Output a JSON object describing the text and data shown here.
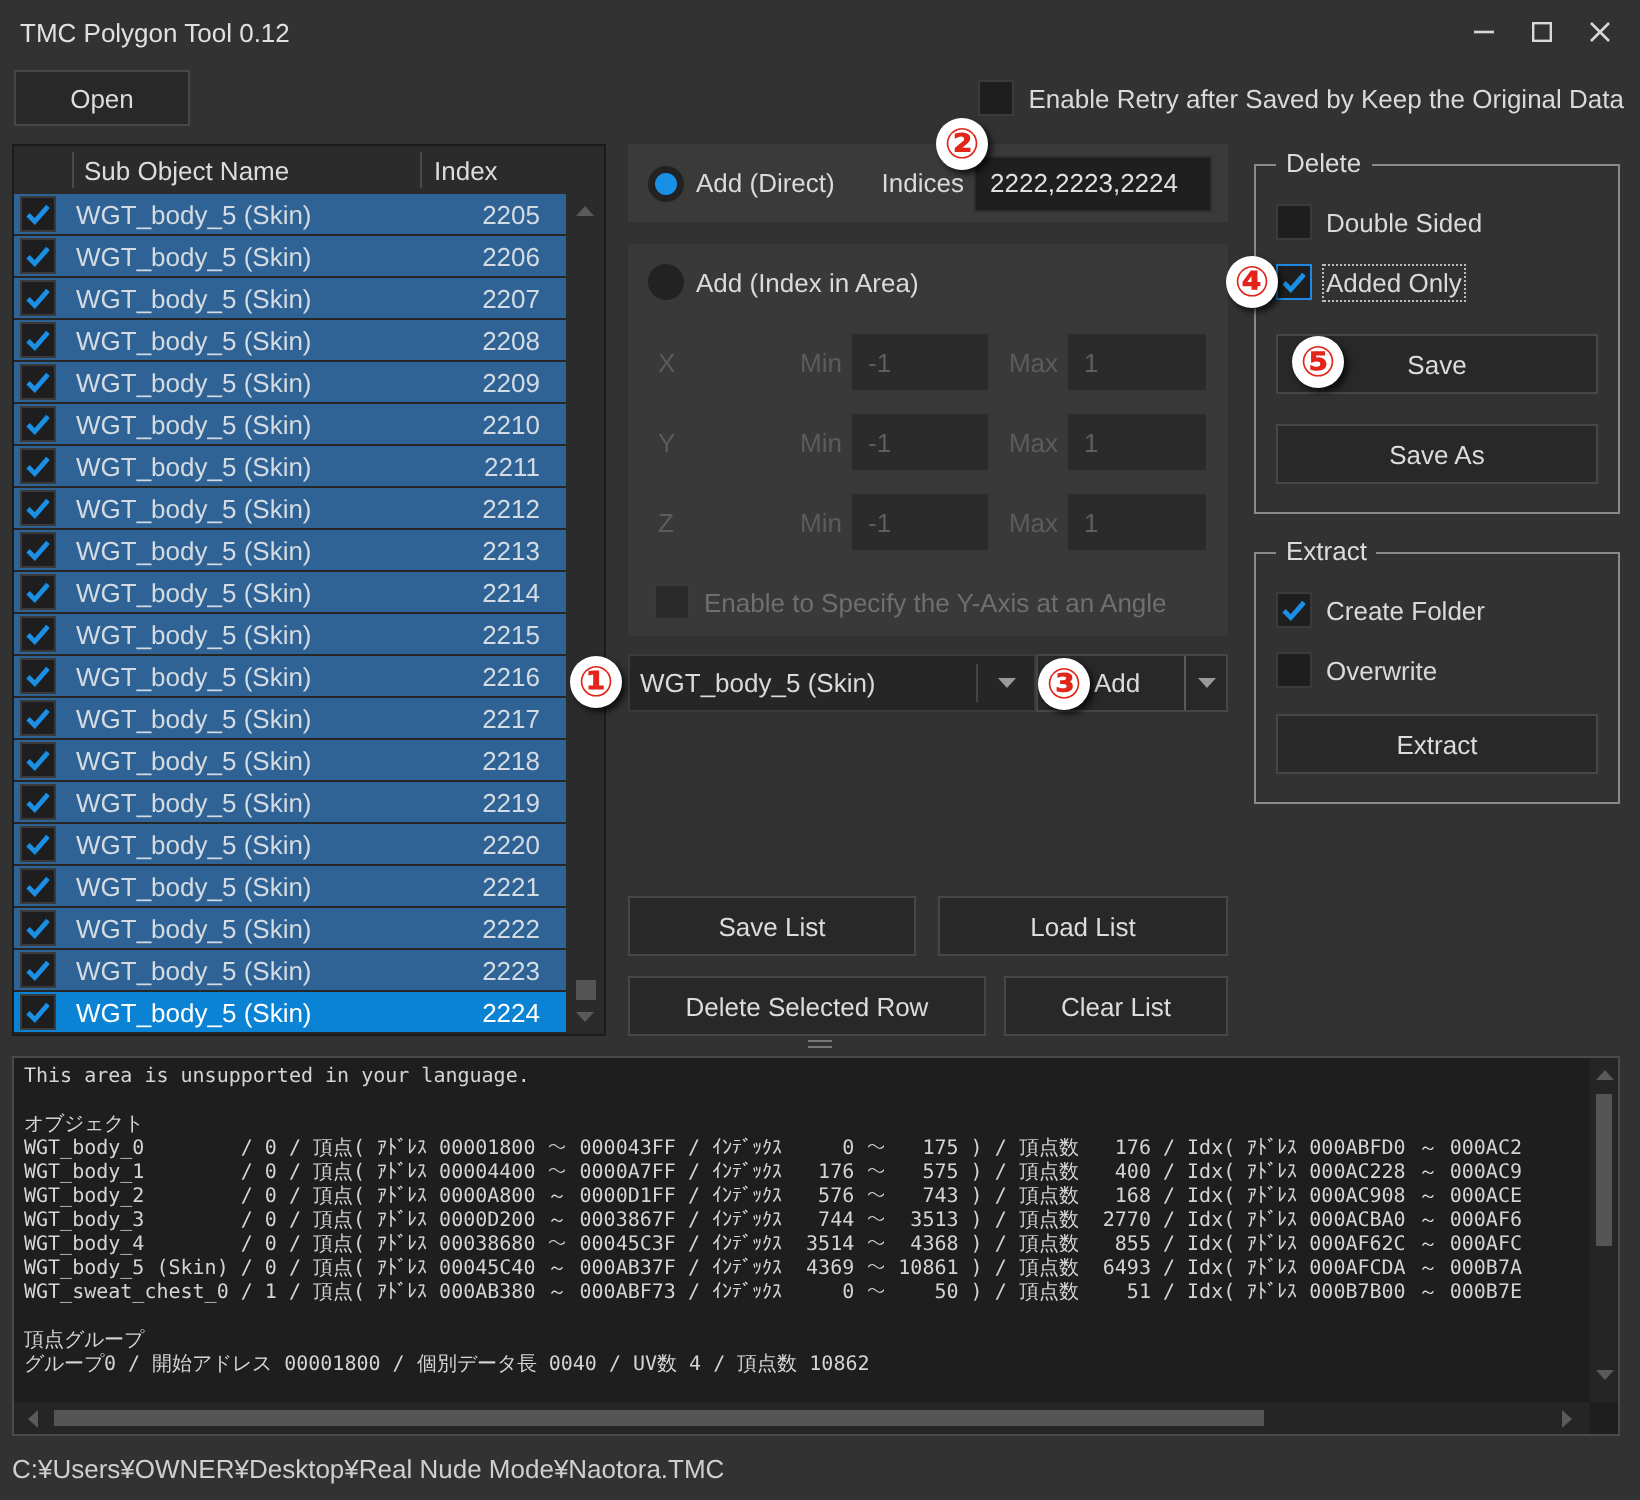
{
  "window": {
    "title": "TMC Polygon Tool 0.12"
  },
  "toolbar": {
    "open_button": "Open",
    "retry_option": {
      "label": "Enable Retry after Saved by Keep the Original Data",
      "checked": false
    }
  },
  "object_list": {
    "columns": [
      "Sub Object Name",
      "Index"
    ],
    "rows": [
      {
        "checked": true,
        "name": "WGT_body_5 (Skin)",
        "index": "2205",
        "selected": false
      },
      {
        "checked": true,
        "name": "WGT_body_5 (Skin)",
        "index": "2206",
        "selected": false
      },
      {
        "checked": true,
        "name": "WGT_body_5 (Skin)",
        "index": "2207",
        "selected": false
      },
      {
        "checked": true,
        "name": "WGT_body_5 (Skin)",
        "index": "2208",
        "selected": false
      },
      {
        "checked": true,
        "name": "WGT_body_5 (Skin)",
        "index": "2209",
        "selected": false
      },
      {
        "checked": true,
        "name": "WGT_body_5 (Skin)",
        "index": "2210",
        "selected": false
      },
      {
        "checked": true,
        "name": "WGT_body_5 (Skin)",
        "index": "2211",
        "selected": false
      },
      {
        "checked": true,
        "name": "WGT_body_5 (Skin)",
        "index": "2212",
        "selected": false
      },
      {
        "checked": true,
        "name": "WGT_body_5 (Skin)",
        "index": "2213",
        "selected": false
      },
      {
        "checked": true,
        "name": "WGT_body_5 (Skin)",
        "index": "2214",
        "selected": false
      },
      {
        "checked": true,
        "name": "WGT_body_5 (Skin)",
        "index": "2215",
        "selected": false
      },
      {
        "checked": true,
        "name": "WGT_body_5 (Skin)",
        "index": "2216",
        "selected": false
      },
      {
        "checked": true,
        "name": "WGT_body_5 (Skin)",
        "index": "2217",
        "selected": false
      },
      {
        "checked": true,
        "name": "WGT_body_5 (Skin)",
        "index": "2218",
        "selected": false
      },
      {
        "checked": true,
        "name": "WGT_body_5 (Skin)",
        "index": "2219",
        "selected": false
      },
      {
        "checked": true,
        "name": "WGT_body_5 (Skin)",
        "index": "2220",
        "selected": false
      },
      {
        "checked": true,
        "name": "WGT_body_5 (Skin)",
        "index": "2221",
        "selected": false
      },
      {
        "checked": true,
        "name": "WGT_body_5 (Skin)",
        "index": "2222",
        "selected": false
      },
      {
        "checked": true,
        "name": "WGT_body_5 (Skin)",
        "index": "2223",
        "selected": false
      },
      {
        "checked": true,
        "name": "WGT_body_5 (Skin)",
        "index": "2224",
        "selected": true
      }
    ]
  },
  "add_direct": {
    "label": "Add (Direct)",
    "selected": true,
    "indices_label": "Indices",
    "indices_value": "2222,2223,2224",
    "annotation": "②"
  },
  "add_area": {
    "label": "Add (Index in Area)",
    "selected": false,
    "disabled": true,
    "axes": [
      {
        "axis": "X",
        "min_label": "Min",
        "min_value": "-1",
        "max_label": "Max",
        "max_value": "1"
      },
      {
        "axis": "Y",
        "min_label": "Min",
        "min_value": "-1",
        "max_label": "Max",
        "max_value": "1"
      },
      {
        "axis": "Z",
        "min_label": "Min",
        "min_value": "-1",
        "max_label": "Max",
        "max_value": "1"
      }
    ],
    "angle_option": {
      "label": "Enable to Specify the Y-Axis at an Angle",
      "checked": false
    }
  },
  "object_select": {
    "value": "WGT_body_5 (Skin)",
    "annotation": "①"
  },
  "add_button": {
    "label": "Add",
    "annotation": "③"
  },
  "list_buttons": [
    {
      "label": "Save List"
    },
    {
      "label": "Load List"
    },
    {
      "label": "Delete Selected Row"
    },
    {
      "label": "Clear List"
    }
  ],
  "delete_group": {
    "title": "Delete",
    "options": [
      {
        "label": "Double Sided",
        "checked": false,
        "focused": false
      },
      {
        "label": "Added Only",
        "checked": true,
        "focused": true,
        "annotation": "④"
      }
    ],
    "buttons": [
      {
        "label": "Save",
        "annotation": "⑤"
      },
      {
        "label": "Save As"
      }
    ]
  },
  "extract_group": {
    "title": "Extract",
    "options": [
      {
        "label": "Create Folder",
        "checked": true,
        "focused": false
      },
      {
        "label": "Overwrite",
        "checked": false,
        "focused": false
      }
    ],
    "buttons": [
      {
        "label": "Extract"
      }
    ]
  },
  "log": {
    "notice": "This area is unsupported in your language.",
    "sections": [
      {
        "title": "オブジェクト",
        "lines": [
          "WGT_body_0        / 0 / 頂点( ｱﾄﾞﾚｽ 00001800 ～ 000043FF / ｲﾝﾃﾞｯｸｽ     0 ～   175 ) / 頂点数   176 / Idx( ｱﾄﾞﾚｽ 000ABFD0 ～ 000AC2",
          "WGT_body_1        / 0 / 頂点( ｱﾄﾞﾚｽ 00004400 ～ 0000A7FF / ｲﾝﾃﾞｯｸｽ   176 ～   575 ) / 頂点数   400 / Idx( ｱﾄﾞﾚｽ 000AC228 ～ 000AC9",
          "WGT_body_2        / 0 / 頂点( ｱﾄﾞﾚｽ 0000A800 ～ 0000D1FF / ｲﾝﾃﾞｯｸｽ   576 ～   743 ) / 頂点数   168 / Idx( ｱﾄﾞﾚｽ 000AC908 ～ 000ACE",
          "WGT_body_3        / 0 / 頂点( ｱﾄﾞﾚｽ 0000D200 ～ 0003867F / ｲﾝﾃﾞｯｸｽ   744 ～  3513 ) / 頂点数  2770 / Idx( ｱﾄﾞﾚｽ 000ACBA0 ～ 000AF6",
          "WGT_body_4        / 0 / 頂点( ｱﾄﾞﾚｽ 00038680 ～ 00045C3F / ｲﾝﾃﾞｯｸｽ  3514 ～  4368 ) / 頂点数   855 / Idx( ｱﾄﾞﾚｽ 000AF62C ～ 000AFC",
          "WGT_body_5 (Skin) / 0 / 頂点( ｱﾄﾞﾚｽ 00045C40 ～ 000AB37F / ｲﾝﾃﾞｯｸｽ  4369 ～ 10861 ) / 頂点数  6493 / Idx( ｱﾄﾞﾚｽ 000AFCDA ～ 000B7A",
          "WGT_sweat_chest_0 / 1 / 頂点( ｱﾄﾞﾚｽ 000AB380 ～ 000ABF73 / ｲﾝﾃﾞｯｸｽ     0 ～    50 ) / 頂点数    51 / Idx( ｱﾄﾞﾚｽ 000B7B00 ～ 000B7E"
        ]
      },
      {
        "title": "頂点グループ",
        "lines": [
          "グループ0 / 開始アドレス 00001800 / 個別データ長 0040 / UV数 4 / 頂点数 10862"
        ]
      }
    ]
  },
  "status_bar": {
    "path": "C:¥Users¥OWNER¥Desktop¥Real Nude Mode¥Naotora.TMC"
  }
}
